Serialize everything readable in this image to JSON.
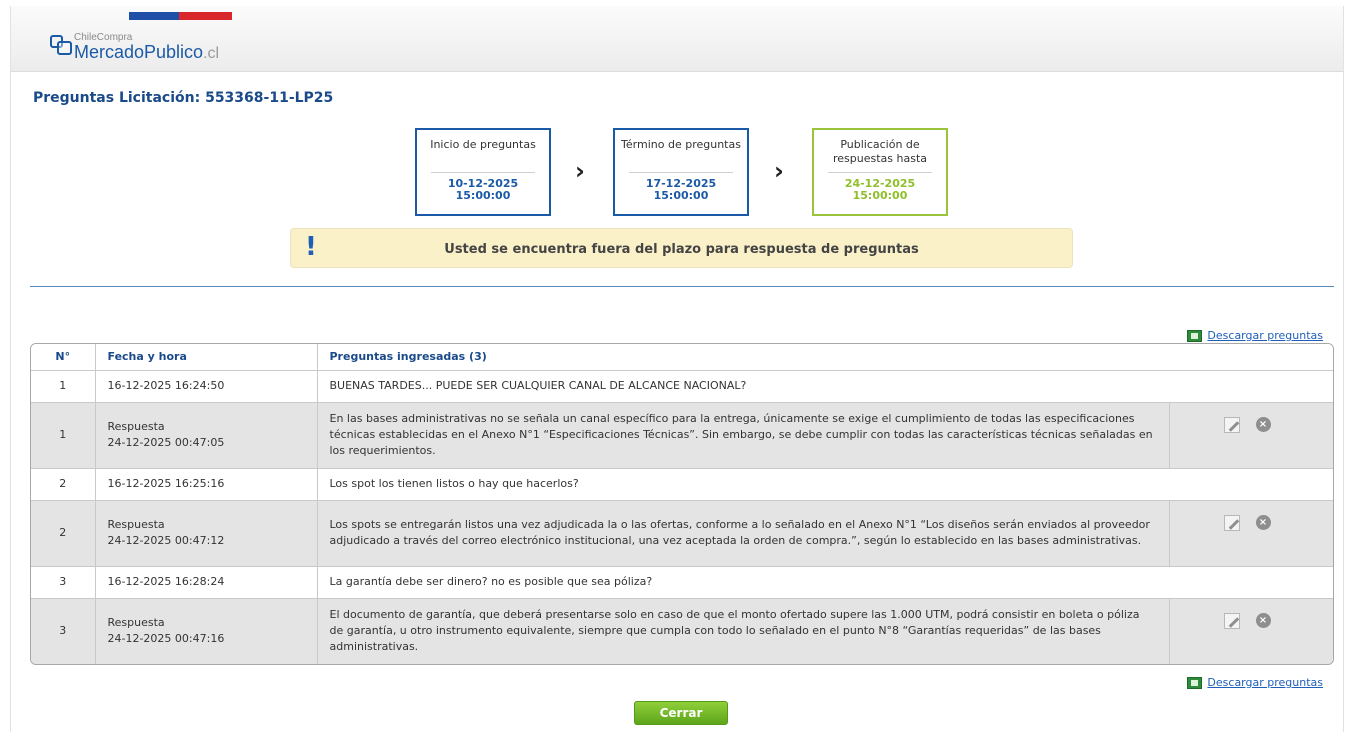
{
  "header": {
    "logo_small": "ChileCompra",
    "logo_main": "MercadoPublico",
    "logo_suffix": ".cl"
  },
  "page_title": "Preguntas Licitación: 553368-11-LP25",
  "steps": [
    {
      "label": "Inicio de preguntas",
      "date": "10-12-2025",
      "time": "15:00:00",
      "status": "active"
    },
    {
      "label": "Término de preguntas",
      "date": "17-12-2025",
      "time": "15:00:00",
      "status": "active"
    },
    {
      "label": "Publicación de respuestas hasta",
      "date": "24-12-2025",
      "time": "15:00:00",
      "status": "done"
    }
  ],
  "alert": {
    "icon": "exclamation-icon",
    "message": "Usted se encuentra fuera del plazo para respuesta de preguntas"
  },
  "download_label": "Descargar preguntas",
  "table": {
    "headers": {
      "num": "N°",
      "datetime": "Fecha y hora",
      "questions": "Preguntas ingresadas (3)"
    },
    "rows": [
      {
        "num": "1",
        "datetime": "16-12-2025 16:24:50",
        "text": "BUENAS TARDES... PUEDE SER CUALQUIER CANAL DE ALCANCE NACIONAL?"
      },
      {
        "num": "1",
        "label": "Respuesta",
        "datetime": "24-12-2025 00:47:05",
        "text": "En las bases administrativas no se señala un canal específico para la entrega, únicamente se exige el cumplimiento de todas las especificaciones técnicas establecidas en el Anexo N°1 “Especificaciones Técnicas”. Sin embargo, se debe cumplir con todas las características técnicas señaladas en los requerimientos."
      },
      {
        "num": "2",
        "datetime": "16-12-2025 16:25:16",
        "text": "Los spot los tienen listos o hay que hacerlos?"
      },
      {
        "num": "2",
        "label": "Respuesta",
        "datetime": "24-12-2025 00:47:12",
        "text": "Los spots se entregarán listos una vez adjudicada la o las ofertas, conforme a lo señalado en el Anexo N°1 “Los diseños serán enviados al proveedor adjudicado a través del correo electrónico institucional, una vez aceptada la orden de compra.”, según lo establecido en las bases administrativas."
      },
      {
        "num": "3",
        "datetime": "16-12-2025 16:28:24",
        "text": "La garantía debe ser dinero? no es posible que sea póliza?"
      },
      {
        "num": "3",
        "label": "Respuesta",
        "datetime": "24-12-2025 00:47:16",
        "text": "El documento de garantía, que deberá presentarse solo en caso de que el monto ofertado supere las 1.000 UTM, podrá consistir en boleta o póliza de garantía, u otro instrumento equivalente, siempre que cumpla con todo lo señalado en el punto N°8 “Garantías requeridas” de las bases administrativas."
      }
    ]
  },
  "close_button": "Cerrar",
  "colors": {
    "primary_blue": "#1b5aa6",
    "done_green": "#9ac43c",
    "alert_bg": "#fbf1c9",
    "button_green": "#6fb52a"
  }
}
